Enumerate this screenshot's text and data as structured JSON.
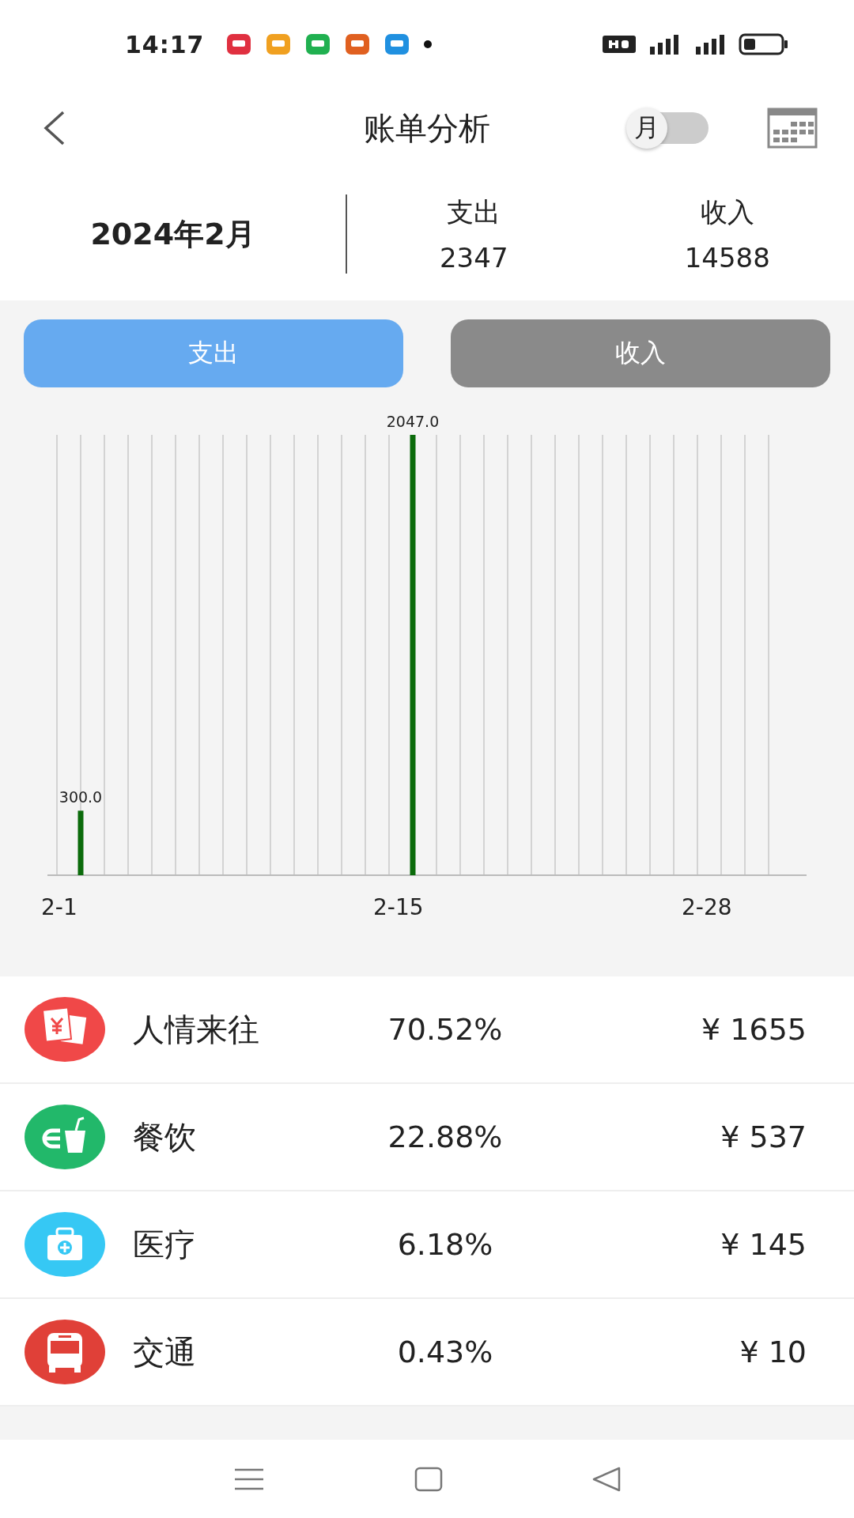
{
  "status_bar": {
    "time": "14:17"
  },
  "header": {
    "title": "账单分析",
    "period_toggle": {
      "label": "月",
      "on": false
    }
  },
  "summary": {
    "month": "2024年2月",
    "stats": [
      {
        "label": "支出",
        "value": "2347"
      },
      {
        "label": "收入",
        "value": "14588"
      }
    ]
  },
  "tabs": [
    {
      "label": "支出",
      "selected": true
    },
    {
      "label": "收入",
      "selected": false
    }
  ],
  "chart_data": {
    "type": "bar",
    "categories": [
      "2-1",
      null,
      null,
      null,
      null,
      null,
      null,
      null,
      null,
      null,
      null,
      null,
      null,
      null,
      "2-15",
      null,
      null,
      null,
      null,
      null,
      null,
      null,
      null,
      null,
      null,
      null,
      null,
      "2-28",
      null,
      null,
      null
    ],
    "values": [
      null,
      300,
      null,
      null,
      null,
      null,
      null,
      null,
      null,
      null,
      null,
      null,
      null,
      null,
      null,
      2047,
      null,
      null,
      null,
      null,
      null,
      null,
      null,
      null,
      null,
      null,
      null,
      null,
      null,
      null,
      null
    ],
    "value_labels": [
      null,
      "300.0",
      null,
      null,
      null,
      null,
      null,
      null,
      null,
      null,
      null,
      null,
      null,
      null,
      null,
      "2047.0",
      null,
      null,
      null,
      null,
      null,
      null,
      null,
      null,
      null,
      null,
      null,
      null,
      null,
      null,
      null
    ],
    "ylim": [
      0,
      2047
    ],
    "grid": true,
    "color": "#0b6b0b"
  },
  "categories": [
    {
      "kind": "gift",
      "name": "人情来往",
      "percent": "70.52%",
      "amount": "¥ 1655",
      "color": "#f04848"
    },
    {
      "kind": "food",
      "name": "餐饮",
      "percent": "22.88%",
      "amount": "¥ 537",
      "color": "#22b86a"
    },
    {
      "kind": "medical",
      "name": "医疗",
      "percent": "6.18%",
      "amount": "¥ 145",
      "color": "#36c8f4"
    },
    {
      "kind": "transport",
      "name": "交通",
      "percent": "0.43%",
      "amount": "¥ 10",
      "color": "#e04038"
    }
  ]
}
